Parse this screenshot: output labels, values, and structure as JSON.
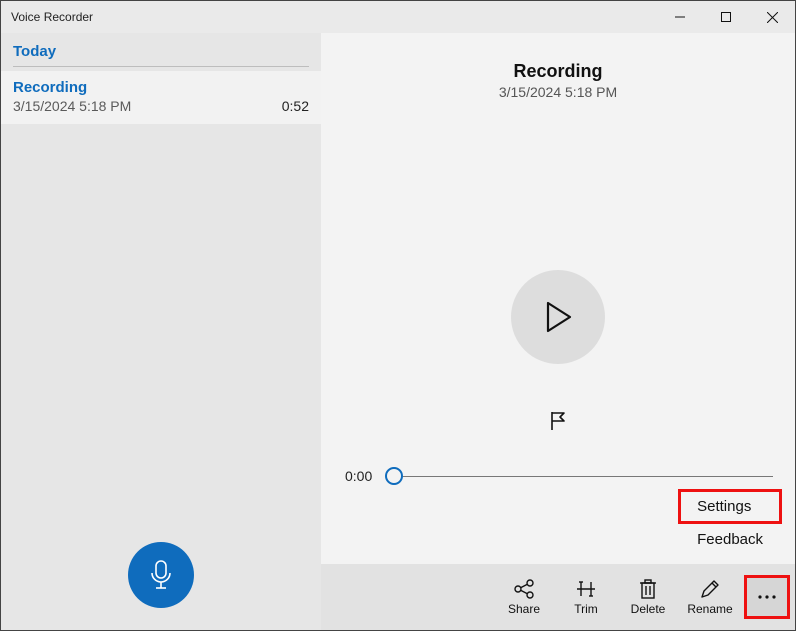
{
  "app": {
    "title": "Voice Recorder"
  },
  "sidebar": {
    "section": "Today",
    "items": [
      {
        "title": "Recording",
        "date": "3/15/2024 5:18 PM",
        "duration": "0:52"
      }
    ]
  },
  "detail": {
    "title": "Recording",
    "date": "3/15/2024 5:18 PM",
    "seek_time": "0:00"
  },
  "popup": {
    "settings": "Settings",
    "feedback": "Feedback"
  },
  "toolbar": {
    "share": "Share",
    "trim": "Trim",
    "delete": "Delete",
    "rename": "Rename"
  }
}
